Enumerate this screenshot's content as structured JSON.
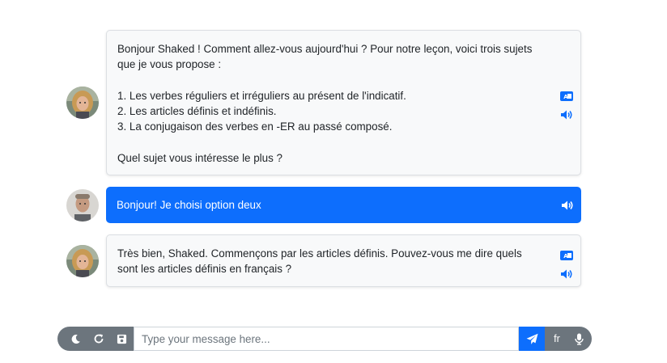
{
  "conversation": {
    "messages": [
      {
        "role": "assistant",
        "text": "Bonjour Shaked ! Comment allez-vous aujourd'hui ? Pour notre leçon, voici trois sujets que je vous propose :\n\n1. Les verbes réguliers et irréguliers au présent de l'indicatif.\n2. Les articles définis et indéfinis.\n3. La conjugaison des verbes en -ER au passé composé.\n\nQuel sujet vous intéresse le plus ?",
        "icons": [
          "translate-icon",
          "speaker-icon"
        ]
      },
      {
        "role": "user",
        "text": "Bonjour! Je choisi option deux",
        "icons": [
          "speaker-icon"
        ]
      },
      {
        "role": "assistant",
        "text": "Très bien, Shaked. Commençons par les articles définis. Pouvez-vous me dire quels sont les articles définis en français ?",
        "icons": [
          "translate-icon",
          "speaker-icon"
        ]
      }
    ]
  },
  "input_bar": {
    "buttons_left": [
      "moon-icon",
      "refresh-icon",
      "save-icon"
    ],
    "placeholder": "Type your message here...",
    "value": "",
    "send_icon": "paper-plane-icon",
    "language_label": "fr",
    "mic_icon": "microphone-icon"
  },
  "colors": {
    "primary": "#0d6efd",
    "assistant_bubble_bg": "#f8f9fa",
    "bar_gray": "#6c757d"
  }
}
